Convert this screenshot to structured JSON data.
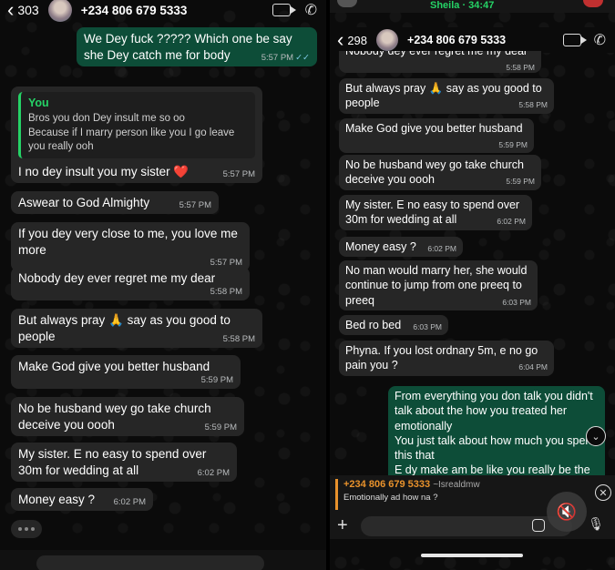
{
  "left": {
    "header": {
      "back_count": "303",
      "contact": "+234 806 679 5333"
    },
    "messages": [
      {
        "dir": "out",
        "text": "We Dey fuck ????? Which one be say she Dey catch me for body",
        "time": "5:57 PM"
      },
      {
        "dir": "in",
        "quote_name": "You",
        "quote_text": "Bros you don Dey insult me so oo\nBecause if I marry person like you I go leave you really ooh",
        "text": "I no dey insult you my sister ❤️",
        "time": "5:57 PM"
      },
      {
        "dir": "in",
        "text": "Aswear to God Almighty",
        "time": "5:57 PM"
      },
      {
        "dir": "in",
        "text": "If you dey very close to me, you love me more",
        "time": "5:57 PM"
      },
      {
        "dir": "in",
        "text": "Nobody dey ever regret me my dear",
        "time": "5:58 PM"
      },
      {
        "dir": "in",
        "text": "But always pray 🙏 say as you good to people",
        "time": "5:58 PM"
      },
      {
        "dir": "in",
        "text": "Make God give you better husband",
        "time": "5:59 PM"
      },
      {
        "dir": "in",
        "text": "No be husband wey go take church deceive you oooh",
        "time": "5:59 PM"
      },
      {
        "dir": "in",
        "text": "My sister. E no easy to spend over 30m for wedding at all",
        "time": "6:02 PM"
      },
      {
        "dir": "in",
        "text": "Money easy ?",
        "time": "6:02 PM"
      }
    ]
  },
  "right": {
    "top_strip": {
      "call_text": "Sheila · 34:47"
    },
    "header": {
      "back_count": "298",
      "contact": "+234 806 679 5333"
    },
    "messages": [
      {
        "dir": "in",
        "text": "Nobody dey ever regret me my dear",
        "time": "5:58 PM"
      },
      {
        "dir": "in",
        "text": "But always pray 🙏 say as you good to people",
        "time": "5:58 PM"
      },
      {
        "dir": "in",
        "text": "Make God give you better husband",
        "time": "5:59 PM"
      },
      {
        "dir": "in",
        "text": "No be husband wey go take church deceive you oooh",
        "time": "5:59 PM"
      },
      {
        "dir": "in",
        "text": "My sister. E no easy to spend over 30m for wedding at all",
        "time": "6:02 PM"
      },
      {
        "dir": "in",
        "text": "Money easy ?",
        "time": "6:02 PM"
      },
      {
        "dir": "in",
        "text": "No man would marry her, she would continue to jump from one preeq to preeq",
        "time": "6:03 PM"
      },
      {
        "dir": "in",
        "text": "Bed ro bed",
        "time": "6:03 PM"
      },
      {
        "dir": "in",
        "text": "Phyna. If you lost ordnary 5m, e no go pain you ?",
        "time": "6:04 PM"
      },
      {
        "dir": "out",
        "text": "From everything you don talk you didn't talk about the how you treated her emotionally\nYou just talk about how much you spend this that\nE dy make am be like you really be the",
        "time": ""
      }
    ],
    "reply": {
      "name": "+234 806 679 5333",
      "tag": "~Isrealdmw",
      "text": "Emotionally ad how na ?"
    }
  },
  "icons": {
    "back": "chevron-left-icon",
    "video": "video-call-icon",
    "call": "phone-call-icon",
    "plus": "plus-icon",
    "mic": "microphone-icon",
    "mute": "muted-speaker-icon"
  }
}
